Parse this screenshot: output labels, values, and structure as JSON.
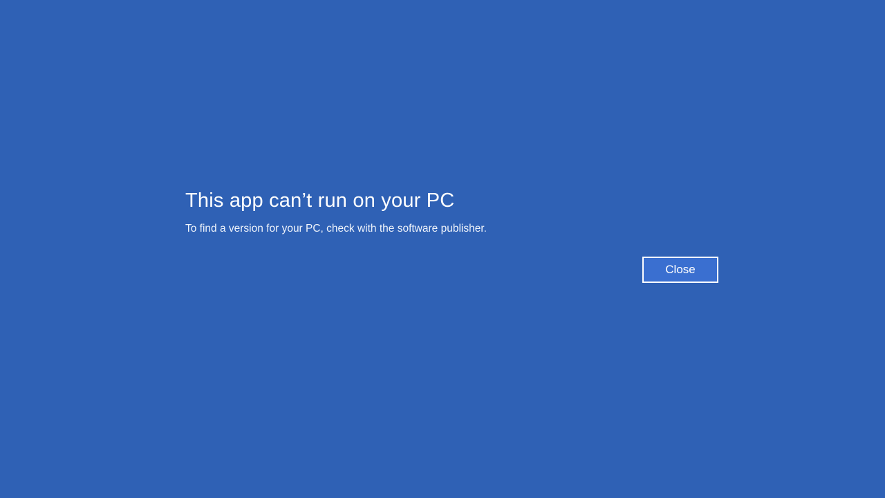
{
  "dialog": {
    "title": "This app can’t run on your PC",
    "message": "To find a version for your PC, check with the software publisher.",
    "close_label": "Close"
  },
  "colors": {
    "background": "#2f61b5",
    "button_fill": "#3a6fd0",
    "text": "#ffffff"
  }
}
